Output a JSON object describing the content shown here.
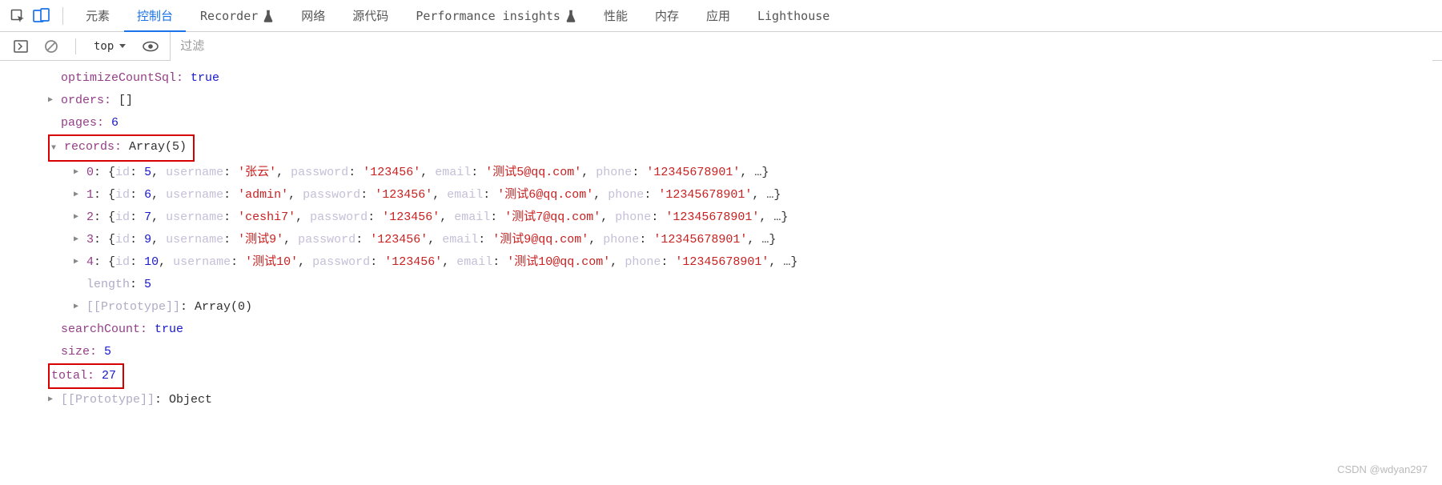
{
  "tabs": {
    "elements": "元素",
    "console": "控制台",
    "recorder": "Recorder",
    "network": "网络",
    "sources": "源代码",
    "perfInsights": "Performance insights",
    "performance": "性能",
    "memory": "内存",
    "application": "应用",
    "lighthouse": "Lighthouse"
  },
  "toolbar": {
    "context": "top",
    "filterPlaceholder": "过滤"
  },
  "obj": {
    "optimizeCountSql": {
      "key": "optimizeCountSql",
      "value": "true"
    },
    "orders": {
      "key": "orders",
      "value": "[]"
    },
    "pages": {
      "key": "pages",
      "value": "6"
    },
    "records": {
      "key": "records",
      "value": "Array(5)"
    },
    "recordItems": [
      {
        "idx": "0",
        "id": "5",
        "username": "'张云'",
        "password": "'123456'",
        "email": "'测试5@qq.com'",
        "phone": "'12345678901'"
      },
      {
        "idx": "1",
        "id": "6",
        "username": "'admin'",
        "password": "'123456'",
        "email": "'测试6@qq.com'",
        "phone": "'12345678901'"
      },
      {
        "idx": "2",
        "id": "7",
        "username": "'ceshi7'",
        "password": "'123456'",
        "email": "'测试7@qq.com'",
        "phone": "'12345678901'"
      },
      {
        "idx": "3",
        "id": "9",
        "username": "'测试9'",
        "password": "'123456'",
        "email": "'测试9@qq.com'",
        "phone": "'12345678901'"
      },
      {
        "idx": "4",
        "id": "10",
        "username": "'测试10'",
        "password": "'123456'",
        "email": "'测试10@qq.com'",
        "phone": "'12345678901'"
      }
    ],
    "length": {
      "key": "length",
      "value": "5"
    },
    "arrayProto": {
      "key": "[[Prototype]]",
      "value": "Array(0)"
    },
    "searchCount": {
      "key": "searchCount",
      "value": "true"
    },
    "size": {
      "key": "size",
      "value": "5"
    },
    "total": {
      "key": "total",
      "value": "27"
    },
    "objProto": {
      "key": "[[Prototype]]",
      "value": "Object"
    }
  },
  "labels": {
    "id": "id",
    "username": "username",
    "password": "password",
    "email": "email",
    "phone": "phone"
  },
  "watermark": "CSDN @wdyan297"
}
